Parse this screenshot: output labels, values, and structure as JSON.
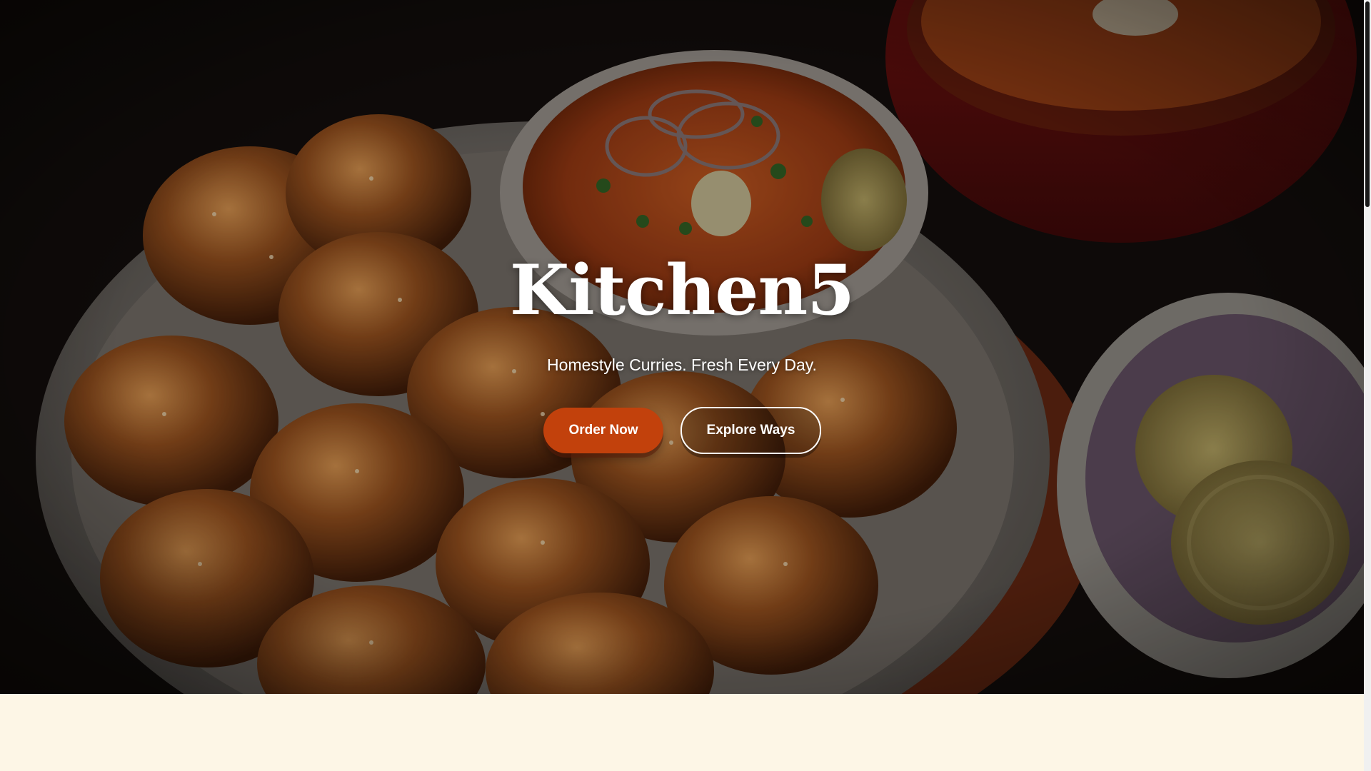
{
  "hero": {
    "title": "Kitchen5",
    "tagline": "Homestyle Curries. Fresh Every Day.",
    "primary_button": "Order Now",
    "secondary_button": "Explore Ways"
  },
  "colors": {
    "accent": "#c2410c",
    "page_background": "#fdf6e6",
    "hero_text": "#ffffff"
  }
}
